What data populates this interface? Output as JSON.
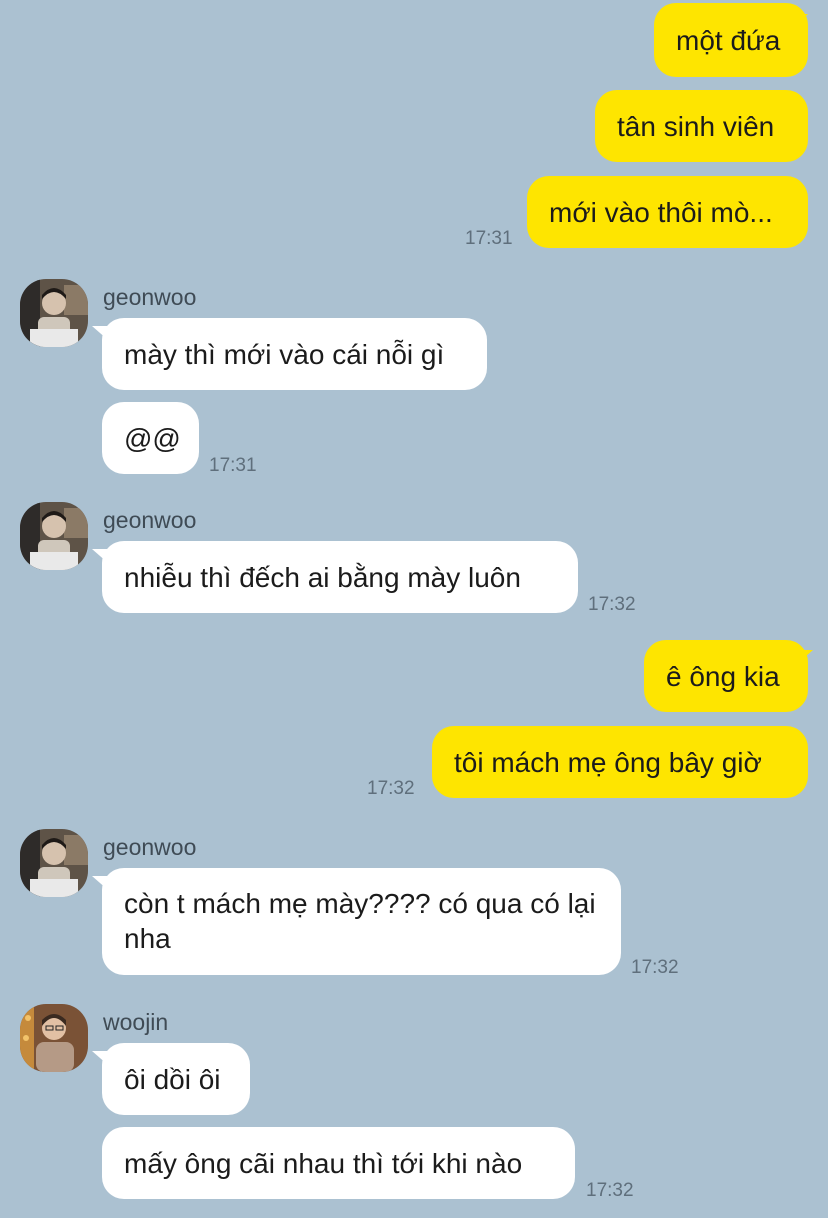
{
  "messages": {
    "m1": "một đứa",
    "m2": "tân sinh viên",
    "m3": "mới vào thôi mò...",
    "t1": "17:31",
    "g1_name": "geonwoo",
    "g1a": "mày thì mới vào cái nỗi gì",
    "g1b": "@@",
    "t2": "17:31",
    "g2_name": "geonwoo",
    "g2": "nhiễu thì đếch ai bằng mày luôn",
    "t3": "17:32",
    "m4": "ê ông kia",
    "m5": "tôi mách mẹ ông bây giờ",
    "t4": "17:32",
    "g3_name": "geonwoo",
    "g3": "còn t mách mẹ mày???? có qua có lại nha",
    "t5": "17:32",
    "w1_name": "woojin",
    "w1a": "ôi dồi ôi",
    "w1b": "mấy ông cãi nhau thì tới khi nào",
    "t6": "17:32"
  },
  "colors": {
    "background": "#abc1d1",
    "my_bubble": "#fee500",
    "their_bubble": "#ffffff"
  },
  "icons": {
    "geonwoo_avatar": "geonwoo-avatar-icon",
    "woojin_avatar": "woojin-avatar-icon"
  }
}
